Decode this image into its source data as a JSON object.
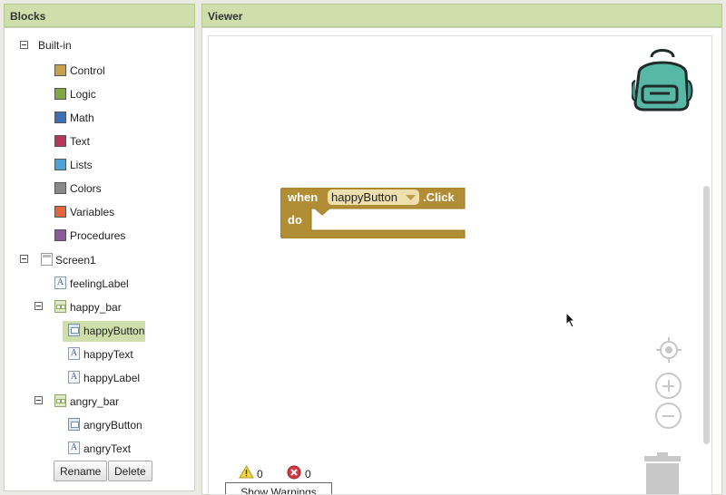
{
  "blocks_panel": {
    "title": "Blocks",
    "builtin_label": "Built-in",
    "categories": [
      {
        "label": "Control",
        "color": "#c8a24a"
      },
      {
        "label": "Logic",
        "color": "#7fa744"
      },
      {
        "label": "Math",
        "color": "#3d6fb5"
      },
      {
        "label": "Text",
        "color": "#b7365a"
      },
      {
        "label": "Lists",
        "color": "#4ba4d8"
      },
      {
        "label": "Colors",
        "color": "#8a8a8a"
      },
      {
        "label": "Variables",
        "color": "#e2663b"
      },
      {
        "label": "Procedures",
        "color": "#8b5a9a"
      }
    ],
    "screen_label": "Screen1",
    "components": {
      "feelingLabel": "feelingLabel",
      "happy_bar": "happy_bar",
      "happyButton": "happyButton",
      "happyText": "happyText",
      "happyLabel": "happyLabel",
      "angry_bar": "angry_bar",
      "angryButton": "angryButton",
      "angryText": "angryText"
    },
    "rename_label": "Rename",
    "delete_label": "Delete"
  },
  "viewer": {
    "title": "Viewer",
    "event_block": {
      "when_label": "when",
      "component": "happyButton",
      "event": ".Click",
      "do_label": "do",
      "color": "#b18e35"
    },
    "warnings_count": "0",
    "errors_count": "0",
    "show_warnings_label": "Show Warnings"
  }
}
